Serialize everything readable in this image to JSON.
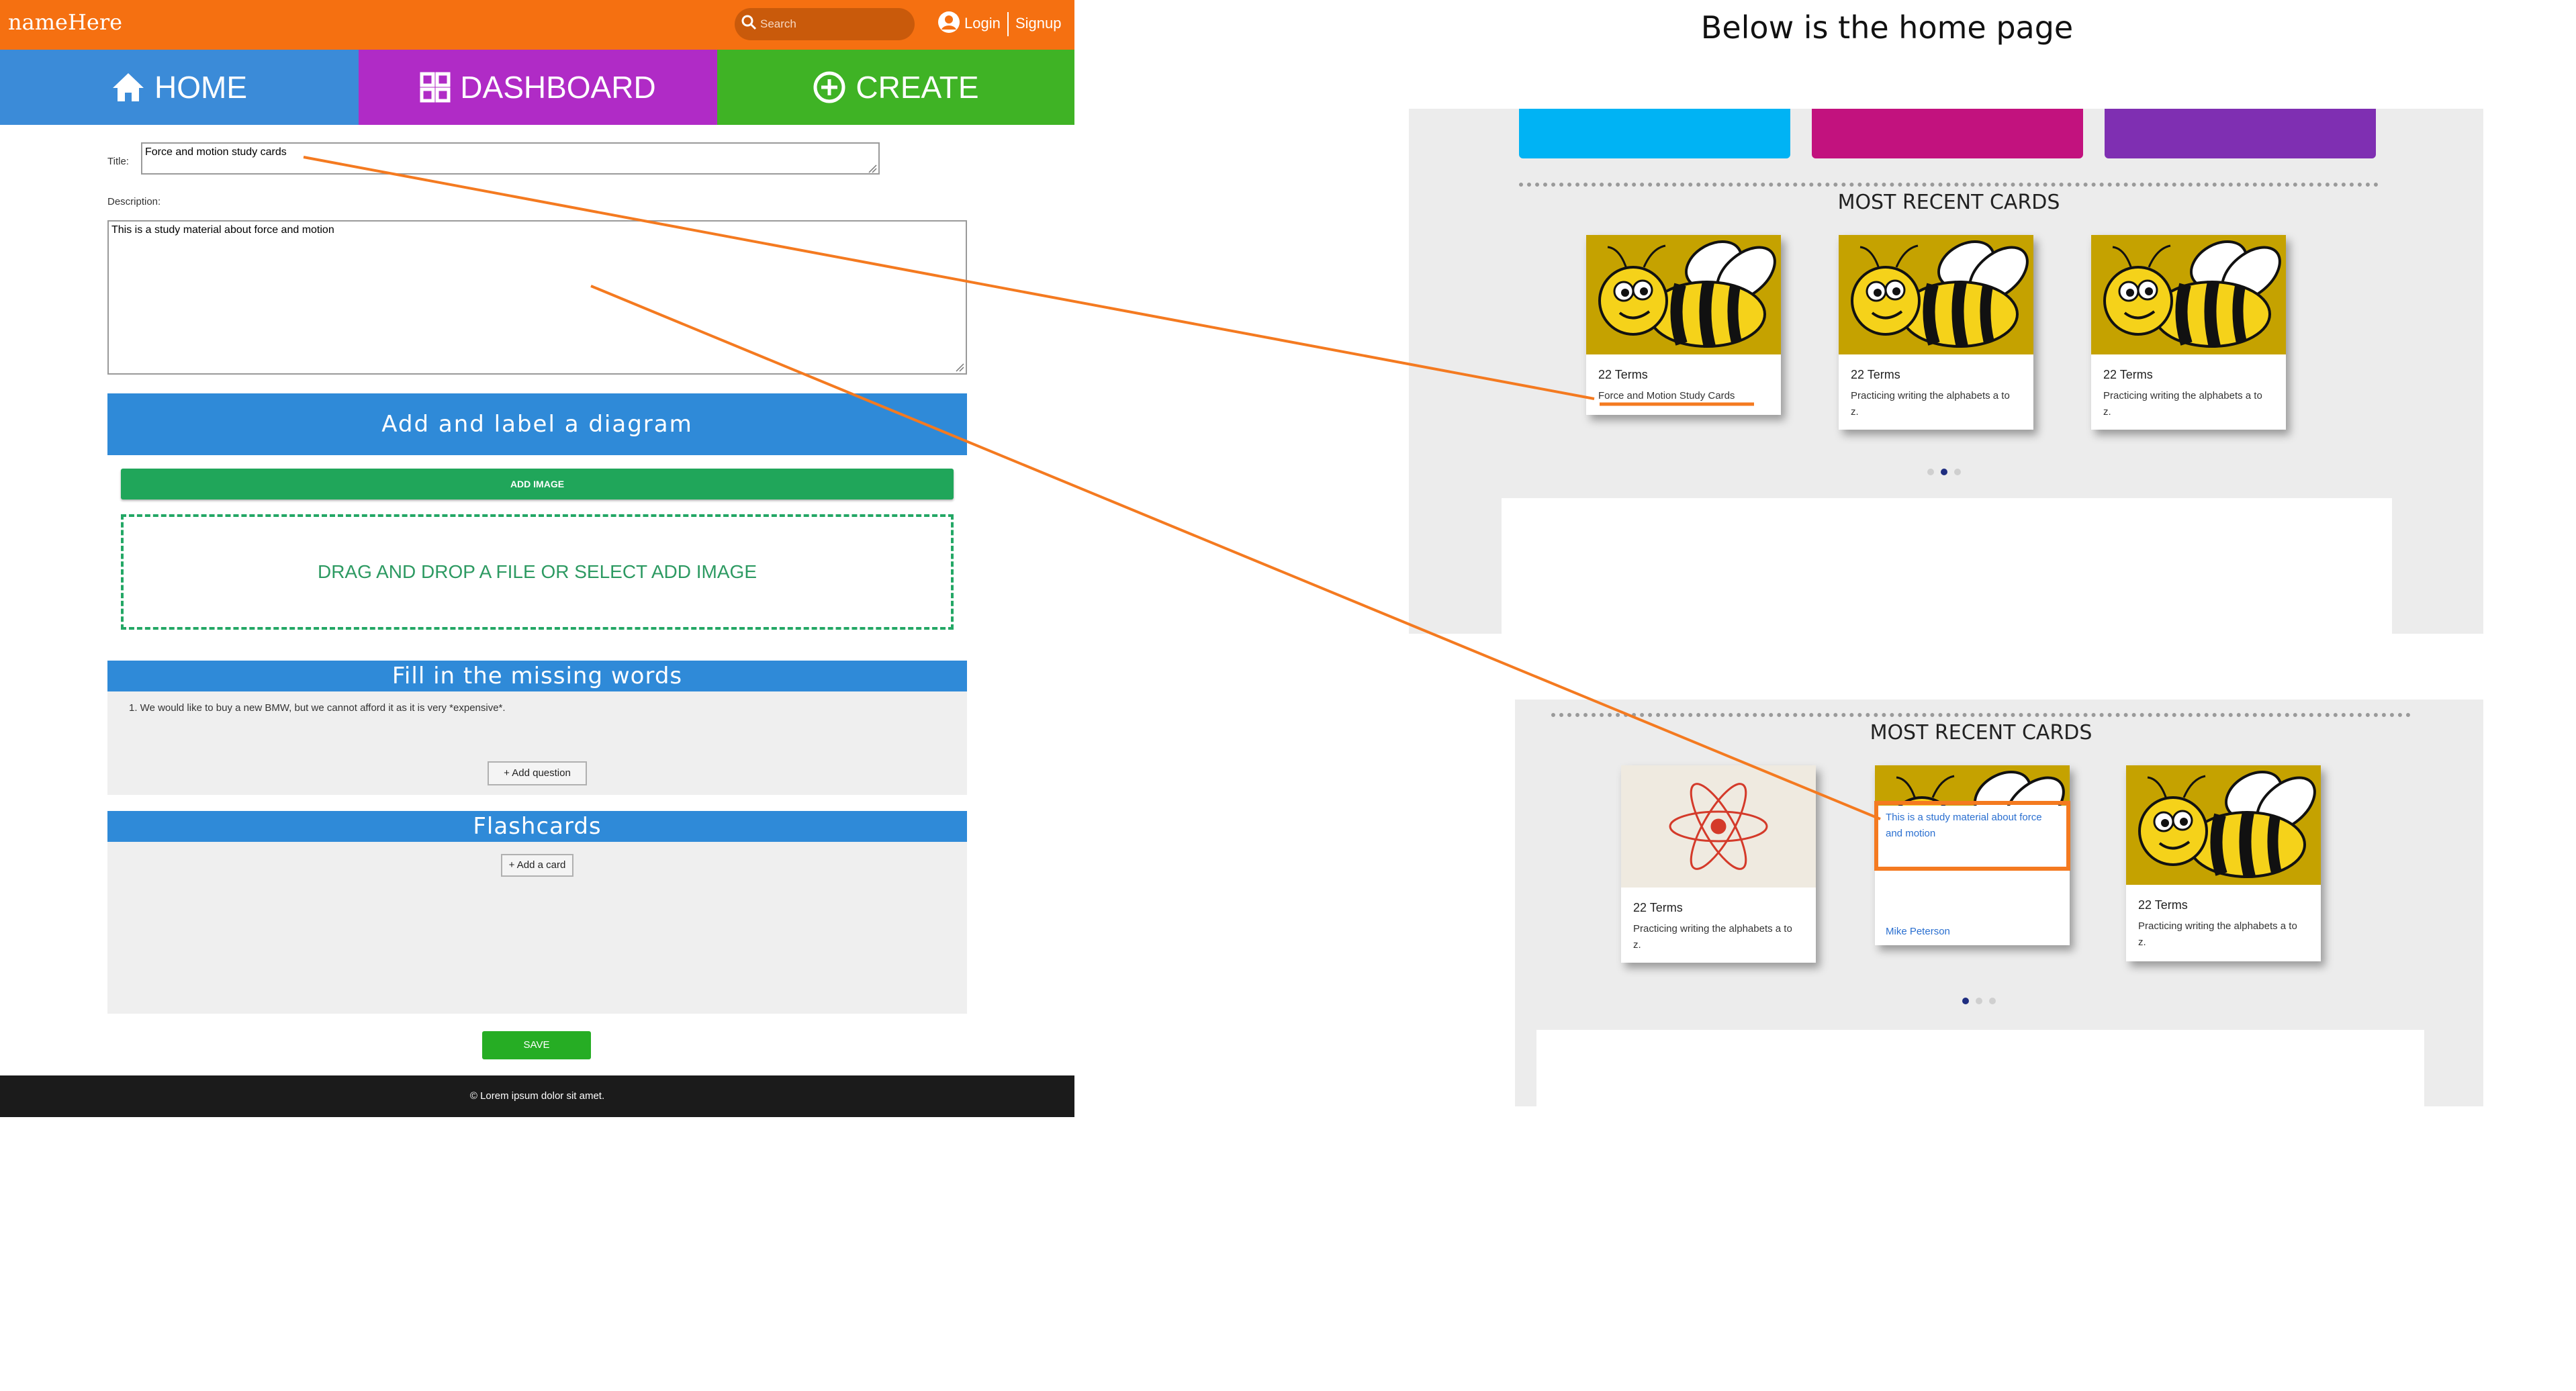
{
  "app": {
    "brand": "nameHere"
  },
  "search": {
    "placeholder": "Search"
  },
  "auth": {
    "login": "Login",
    "signup": "Signup"
  },
  "nav": {
    "home": "HOME",
    "dashboard": "DASHBOARD",
    "create": "CREATE"
  },
  "form": {
    "title_label": "Title:",
    "title_value": "Force and motion study cards",
    "description_label": "Description:",
    "description_value": "This is a study material about force and motion"
  },
  "diagram": {
    "heading": "Add and label a diagram",
    "add_image": "ADD IMAGE",
    "dropzone": "DRAG AND DROP A FILE OR SELECT ADD IMAGE"
  },
  "fill_words": {
    "heading": "Fill in the missing words",
    "question_1": "1. We would like to buy a new BMW, but we cannot afford it as it is very *expensive*.",
    "add_question": "+ Add question"
  },
  "flashcards": {
    "heading": "Flashcards",
    "add_card": "+ Add a card"
  },
  "save": "SAVE",
  "footer": "© Lorem ipsum dolor sit amet.",
  "preview": {
    "caption": "Below is the home page",
    "section_heading": "MOST RECENT CARDS",
    "top_cards": [
      {
        "terms": "22 Terms",
        "desc": "Force and Motion Study Cards"
      },
      {
        "terms": "22 Terms",
        "desc": "Practicing writing the alphabets a to z."
      },
      {
        "terms": "22 Terms",
        "desc": "Practicing writing the alphabets a to z."
      }
    ],
    "bottom_cards": [
      {
        "terms": "22 Terms",
        "desc": "Practicing writing the alphabets a to z."
      },
      {
        "hover_desc": "This is a study material about force and motion",
        "author": "Mike Peterson"
      },
      {
        "terms": "22 Terms",
        "desc": "Practicing writing the alphabets a to z."
      }
    ]
  },
  "colors": {
    "topbar": "#f57011",
    "home_tab": "#3b8bd8",
    "dashboard_tab": "#b02bc6",
    "create_tab": "#3fb325",
    "section_bar": "#2f8ad8",
    "annotation": "#f47a20"
  }
}
